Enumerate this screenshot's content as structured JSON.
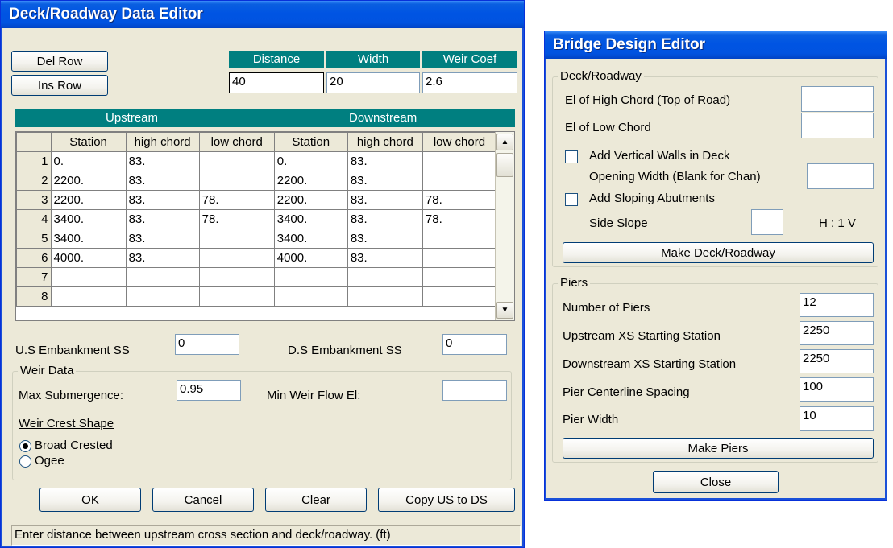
{
  "deck_editor": {
    "title": "Deck/Roadway Data Editor",
    "del_row": "Del Row",
    "ins_row": "Ins Row",
    "headers": {
      "distance": "Distance",
      "width": "Width",
      "weir_coef": "Weir Coef"
    },
    "values": {
      "distance": "40",
      "width": "20",
      "weir_coef": "2.6"
    },
    "upstream_label": "Upstream",
    "downstream_label": "Downstream",
    "columns": [
      "Station",
      "high chord",
      "low chord",
      "Station",
      "high chord",
      "low chord"
    ],
    "rows": [
      {
        "n": "1",
        "us_station": "0.",
        "us_high": "83.",
        "us_low": "",
        "ds_station": "0.",
        "ds_high": "83.",
        "ds_low": ""
      },
      {
        "n": "2",
        "us_station": "2200.",
        "us_high": "83.",
        "us_low": "",
        "ds_station": "2200.",
        "ds_high": "83.",
        "ds_low": ""
      },
      {
        "n": "3",
        "us_station": "2200.",
        "us_high": "83.",
        "us_low": "78.",
        "ds_station": "2200.",
        "ds_high": "83.",
        "ds_low": "78."
      },
      {
        "n": "4",
        "us_station": "3400.",
        "us_high": "83.",
        "us_low": "78.",
        "ds_station": "3400.",
        "ds_high": "83.",
        "ds_low": "78."
      },
      {
        "n": "5",
        "us_station": "3400.",
        "us_high": "83.",
        "us_low": "",
        "ds_station": "3400.",
        "ds_high": "83.",
        "ds_low": ""
      },
      {
        "n": "6",
        "us_station": "4000.",
        "us_high": "83.",
        "us_low": "",
        "ds_station": "4000.",
        "ds_high": "83.",
        "ds_low": ""
      },
      {
        "n": "7",
        "us_station": "",
        "us_high": "",
        "us_low": "",
        "ds_station": "",
        "ds_high": "",
        "ds_low": ""
      },
      {
        "n": "8",
        "us_station": "",
        "us_high": "",
        "us_low": "",
        "ds_station": "",
        "ds_high": "",
        "ds_low": ""
      }
    ],
    "us_embankment_label": "U.S Embankment SS",
    "us_embankment_value": "0",
    "ds_embankment_label": "D.S Embankment SS",
    "ds_embankment_value": "0",
    "weir_data_label": "Weir Data",
    "max_submergence_label": "Max  Submergence:",
    "max_submergence_value": "0.95",
    "min_weir_flow_label": "Min Weir Flow El:",
    "min_weir_flow_value": "",
    "weir_crest_shape_label": "Weir Crest Shape",
    "broad_crested": "Broad Crested",
    "ogee": "Ogee",
    "ok": "OK",
    "cancel": "Cancel",
    "clear": "Clear",
    "copy_us_to_ds": "Copy US to DS",
    "status": "Enter distance between upstream cross section and deck/roadway. (ft)"
  },
  "bridge_editor": {
    "title": "Bridge Design Editor",
    "deck_group": "Deck/Roadway",
    "high_chord_label": "El of High Chord (Top of Road)",
    "high_chord_value": "",
    "low_chord_label": "El of Low Chord",
    "low_chord_value": "",
    "vertical_walls_label": "Add Vertical Walls in Deck",
    "opening_width_label": "Opening Width (Blank for Chan)",
    "opening_width_value": "",
    "sloping_abutments_label": "Add Sloping Abutments",
    "side_slope_label": "Side Slope",
    "side_slope_value": "",
    "side_slope_unit": "H : 1 V",
    "make_deck": "Make Deck/Roadway",
    "piers_group": "Piers",
    "num_piers_label": "Number of Piers",
    "num_piers_value": "12",
    "upstream_xs_label": "Upstream XS Starting Station",
    "upstream_xs_value": "2250",
    "downstream_xs_label": "Downstream XS Starting Station",
    "downstream_xs_value": "2250",
    "spacing_label": "Pier Centerline Spacing",
    "spacing_value": "100",
    "pier_width_label": "Pier Width",
    "pier_width_value": "10",
    "make_piers": "Make Piers",
    "close": "Close"
  }
}
